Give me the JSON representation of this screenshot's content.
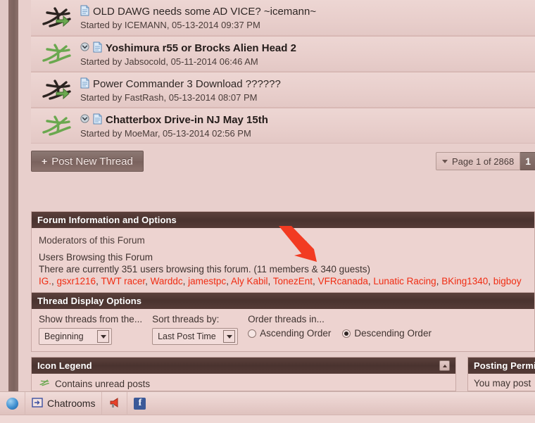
{
  "threads": [
    {
      "icon": "runner-read-icon",
      "title": "OLD DAWG needs some AD VICE? ~icemann~",
      "started": "Started by ICEMANN, 05-13-2014 09:37 PM",
      "unread": false,
      "has_dot": false
    },
    {
      "icon": "runner-unread-icon",
      "title": "Yoshimura r55 or Brocks Alien Head 2",
      "started": "Started by Jabsocold, 05-11-2014 06:46 AM",
      "unread": true,
      "has_dot": true
    },
    {
      "icon": "runner-read-icon",
      "title": "Power Commander 3 Download ??????",
      "started": "Started by FastRash, 05-13-2014 08:07 PM",
      "unread": false,
      "has_dot": false
    },
    {
      "icon": "runner-unread-icon",
      "title": "Chatterbox Drive-in NJ May 15th",
      "started": "Started by MoeMar, 05-13-2014 02:56 PM",
      "unread": true,
      "has_dot": true
    }
  ],
  "actions": {
    "post_new_thread": "Post New Thread",
    "plus": "+",
    "page_jump": "Page 1 of 2868",
    "current_page": "1"
  },
  "forum_info": {
    "title": "Forum Information and Options",
    "moderators_label": "Moderators of this Forum",
    "browsing_label": "Users Browsing this Forum",
    "browsing_count": "There are currently 351 users browsing this forum. (11 members & 340 guests)",
    "users": [
      "IG.",
      "gsxr1216",
      "TWT racer",
      "Warddc",
      "jamestpc",
      "Aly Kabil",
      "TonezEnt",
      "VFRcanada",
      "Lunatic Racing",
      "BKing1340",
      "bigboy"
    ]
  },
  "thread_display": {
    "title": "Thread Display Options",
    "show_label": "Show threads from the...",
    "show_value": "Beginning",
    "sort_label": "Sort threads by:",
    "sort_value": "Last Post Time",
    "order_label": "Order threads in...",
    "ascending_label": "Ascending Order",
    "descending_label": "Descending Order",
    "order_selected": "descending"
  },
  "icon_legend": {
    "title": "Icon Legend",
    "items": [
      {
        "label": "Contains unread posts"
      }
    ]
  },
  "posting_permissions": {
    "title": "Posting Permi",
    "line": "You may post"
  },
  "taskbar": {
    "items": [
      {
        "name": "browser-globe-icon",
        "label": ""
      },
      {
        "name": "chatrooms-button",
        "label": "Chatrooms"
      },
      {
        "name": "megaphone-icon",
        "label": ""
      },
      {
        "name": "facebook-icon",
        "label": "f"
      }
    ]
  },
  "colors": {
    "page_bg": "#e8cfcc",
    "panel_head": "#4a332f",
    "link_red": "#f02c12",
    "button_brown": "#7a625d",
    "annotation_red": "#f23b22"
  }
}
